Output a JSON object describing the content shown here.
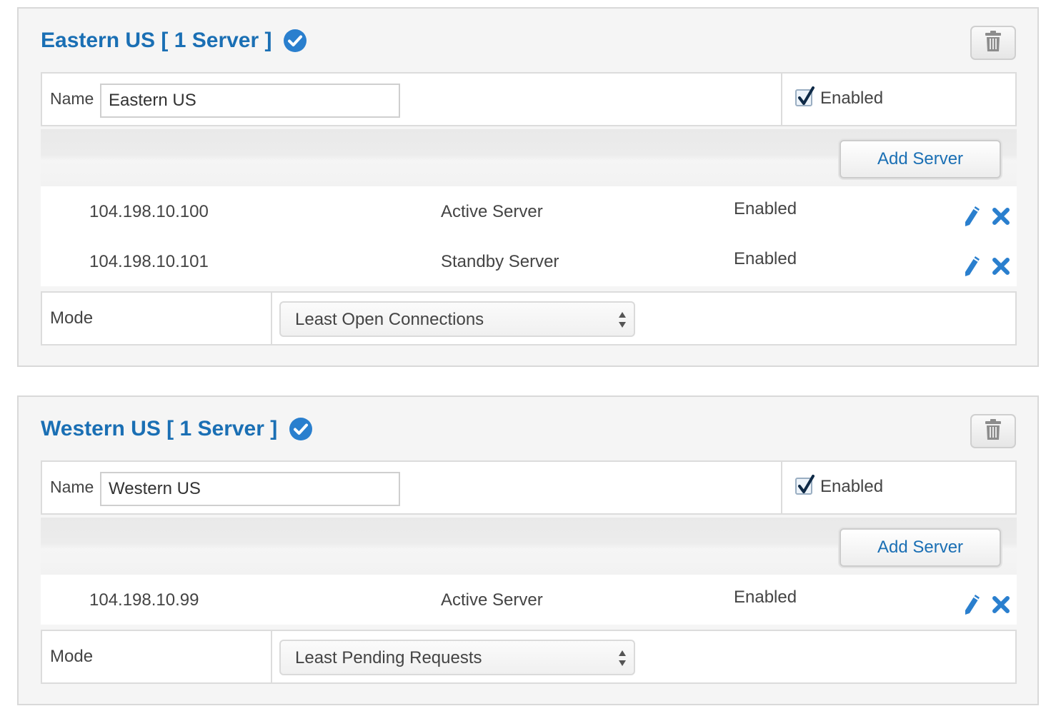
{
  "groups": [
    {
      "title": "Eastern US [ 1 Server ]",
      "name_label": "Name",
      "name_value": "Eastern US",
      "enabled_label": "Enabled",
      "enabled_checked": true,
      "add_server_label": "Add Server",
      "servers": [
        {
          "ip": "104.198.10.100",
          "role": "Active Server",
          "status": "Enabled"
        },
        {
          "ip": "104.198.10.101",
          "role": "Standby Server",
          "status": "Enabled"
        }
      ],
      "mode_label": "Mode",
      "mode_value": "Least Open Connections"
    },
    {
      "title": "Western US [ 1 Server ]",
      "name_label": "Name",
      "name_value": "Western US",
      "enabled_label": "Enabled",
      "enabled_checked": true,
      "add_server_label": "Add Server",
      "servers": [
        {
          "ip": "104.198.10.99",
          "role": "Active Server",
          "status": "Enabled"
        }
      ],
      "mode_label": "Mode",
      "mode_value": "Least Pending Requests"
    }
  ],
  "icons": {
    "header_status": "check-circle-icon",
    "delete_group": "trash-icon",
    "edit_server": "pencil-icon",
    "remove_server": "close-icon",
    "select_arrows": "updown-arrows-icon"
  },
  "colors": {
    "accent": "#1a6fb4",
    "check_circle": "#2a7fce",
    "panel_background": "#f5f5f5"
  }
}
